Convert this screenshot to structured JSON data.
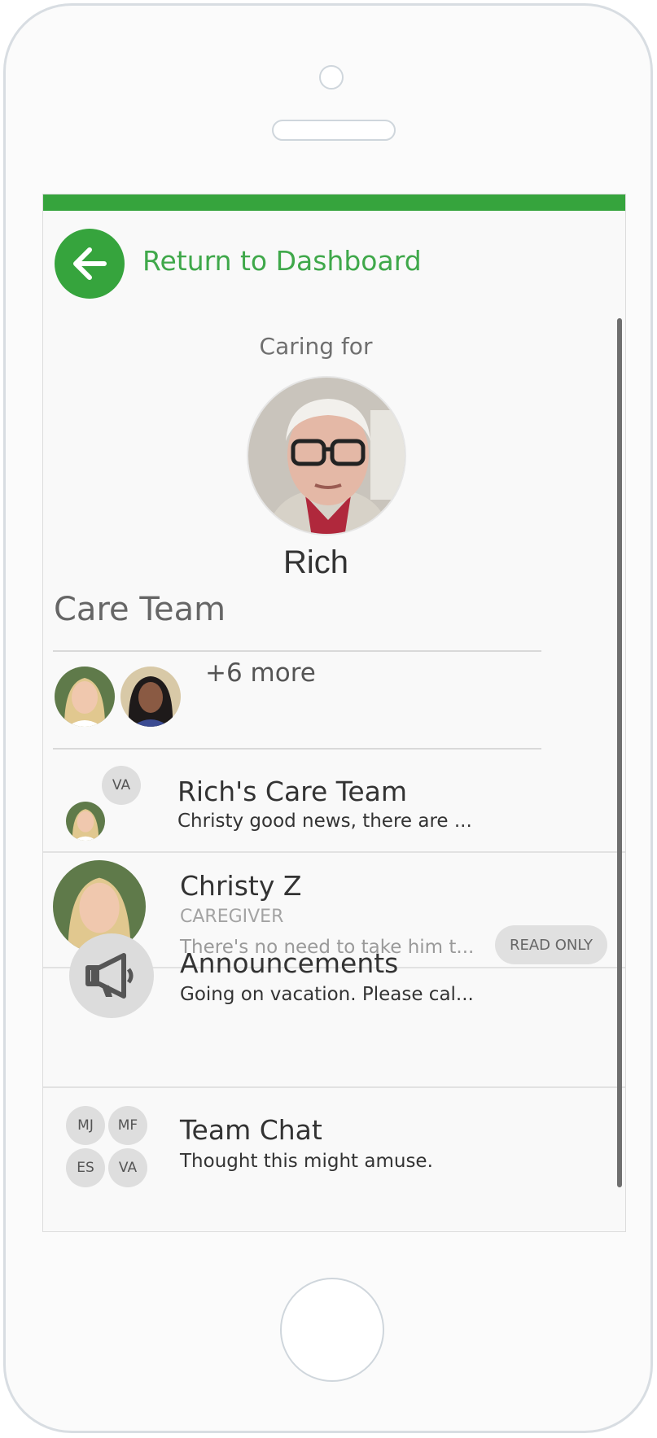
{
  "header": {
    "back_label": "Return to Dashboard"
  },
  "patient": {
    "caring_for_label": "Caring for",
    "name": "Rich"
  },
  "care_team": {
    "title": "Care Team",
    "more_label": "+6 more"
  },
  "conversations": [
    {
      "title": "Rich's Care Team",
      "preview": "Christy good news, there are ...",
      "initials": [
        "VA"
      ]
    },
    {
      "title": "Christy Z",
      "role": "CAREGIVER",
      "preview": "There's no need to take him t..."
    },
    {
      "title": "Announcements",
      "preview": "Going on vacation. Please cal...",
      "badge": "READ ONLY",
      "icon": "megaphone-icon"
    },
    {
      "title": "Team Chat",
      "preview": "Thought this might amuse.",
      "initials": [
        "MJ",
        "MF",
        "ES",
        "VA"
      ]
    }
  ],
  "colors": {
    "accent": "#36a43d",
    "badge_bg": "#e0e0e0"
  }
}
